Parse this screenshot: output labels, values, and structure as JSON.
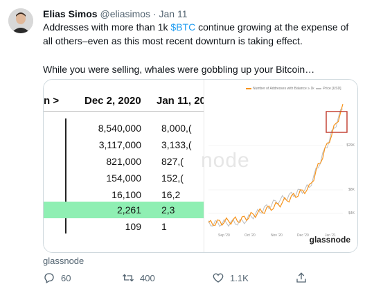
{
  "tweet": {
    "name": "Elias Simos",
    "handle": "@eliasimos",
    "separator": "·",
    "date": "Jan 11",
    "text_before": "Addresses with more than 1k ",
    "cashtag": "$BTC",
    "text_after": " continue growing at the expense of all others–even as this most recent downturn is taking effect.",
    "text_2": "While you were selling, whales were gobbling up your Bitcoin…",
    "source": "glassnode"
  },
  "table": {
    "header_arrow": "n >",
    "col1": "Dec 2, 2020",
    "col2": "Jan 11, 20",
    "rows": [
      {
        "a": "8,540,000",
        "b": "8,000,("
      },
      {
        "a": "3,117,000",
        "b": "3,133,("
      },
      {
        "a": "821,000",
        "b": "827,("
      },
      {
        "a": "154,000",
        "b": "152,("
      },
      {
        "a": "16,100",
        "b": "16,2"
      },
      {
        "a": "2,261",
        "b": "2,3"
      },
      {
        "a": "109",
        "b": "1"
      }
    ]
  },
  "chart": {
    "legend_1": "Number of Addresses with Balance ≥ 1k",
    "legend_2": "Price [USD]",
    "watermark": "node",
    "brand": "glassnode",
    "yticks": [
      "$29K",
      "$8K",
      "$4K"
    ],
    "xticks": [
      "Sep '20",
      "Oct '20",
      "Nov '20",
      "Dec '20",
      "Jan '21"
    ],
    "colors": {
      "addresses": "#f7931a",
      "price": "#bdbdbd",
      "highlight": "#c0392b"
    }
  },
  "chart_data": {
    "type": "line",
    "title": "",
    "x": [
      "Sep '20",
      "Oct '20",
      "Nov '20",
      "Dec '20",
      "Jan '21"
    ],
    "series": [
      {
        "name": "Number of Addresses with Balance ≥ 1k",
        "values": [
          2100,
          2110,
          2140,
          2180,
          2360
        ]
      },
      {
        "name": "Price [USD]",
        "values": [
          10300,
          10700,
          15500,
          19000,
          38000
        ]
      }
    ]
  },
  "actions": {
    "reply_count": "60",
    "retweet_count": "400",
    "like_count": "1.1K"
  }
}
